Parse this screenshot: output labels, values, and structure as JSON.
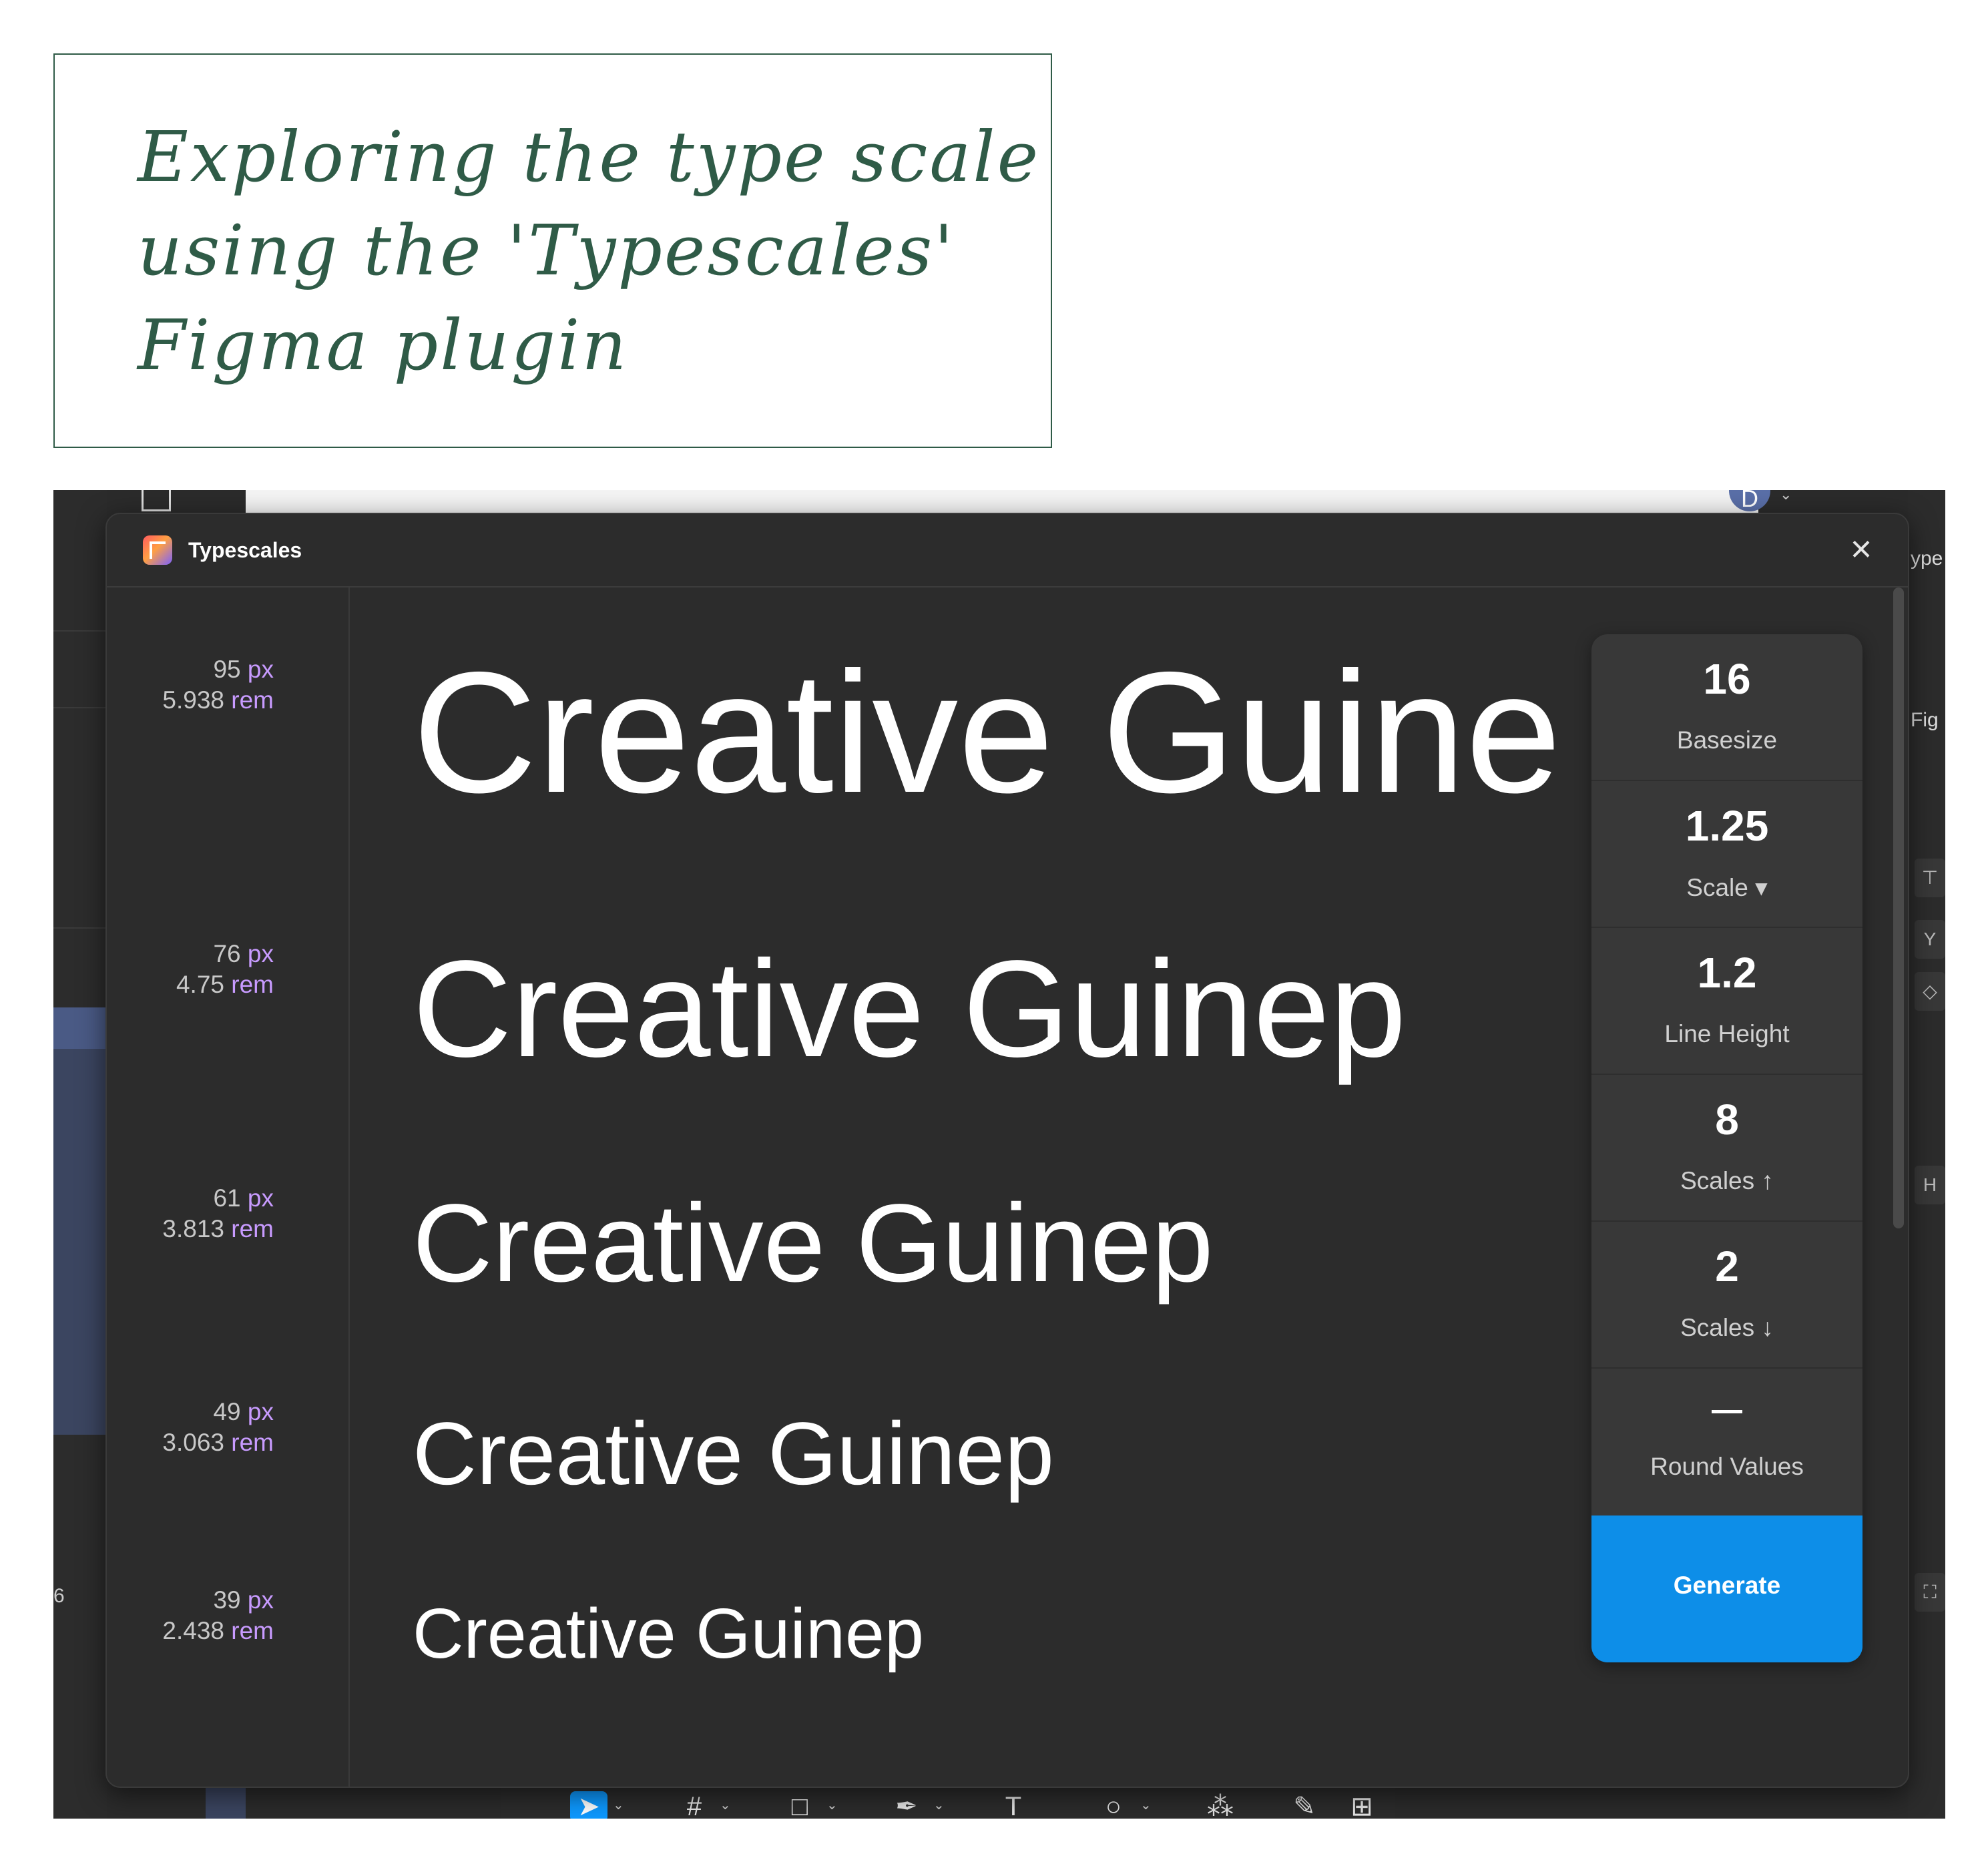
{
  "note": {
    "lines": [
      "Exploring the type scale",
      "using the 'Typescales'",
      "Figma plugin"
    ]
  },
  "background": {
    "avatar_initial": "D",
    "right_panel_labels": [
      "ype",
      "Fig",
      "Y",
      "H"
    ],
    "left_char": "6"
  },
  "plugin": {
    "title": "Typescales",
    "close_icon": "×",
    "sizes": [
      {
        "px": "95",
        "rem": "5.938"
      },
      {
        "px": "76",
        "rem": "4.75"
      },
      {
        "px": "61",
        "rem": "3.813"
      },
      {
        "px": "49",
        "rem": "3.063"
      },
      {
        "px": "39",
        "rem": "2.438"
      }
    ],
    "unit_px": "px",
    "unit_rem": "rem",
    "samples": [
      "Creative Guine",
      "Creative Guinep",
      "Creative Guinep",
      "Creative Guinep",
      "Creative Guinep"
    ],
    "settings": {
      "basesize": {
        "value": "16",
        "label": "Basesize"
      },
      "scale": {
        "value": "1.25",
        "label": "Scale ▾"
      },
      "line_height": {
        "value": "1.2",
        "label": "Line Height"
      },
      "scales_up": {
        "value": "8",
        "label": "Scales ↑"
      },
      "scales_down": {
        "value": "2",
        "label": "Scales ↓"
      },
      "round_values": {
        "label": "Round Values"
      }
    },
    "generate_label": "Generate"
  },
  "toolbar": {
    "icons": [
      "move-icon",
      "frame-icon",
      "rectangle-icon",
      "pen-icon",
      "text-icon",
      "ellipse-icon",
      "components-icon",
      "draw-icon",
      "dev-mode-icon",
      "code-icon"
    ]
  },
  "colors": {
    "note_ink": "#2f5b47",
    "plugin_bg": "#2c2c2c",
    "accent": "#0d8ee8",
    "unit": "#c89bff"
  }
}
